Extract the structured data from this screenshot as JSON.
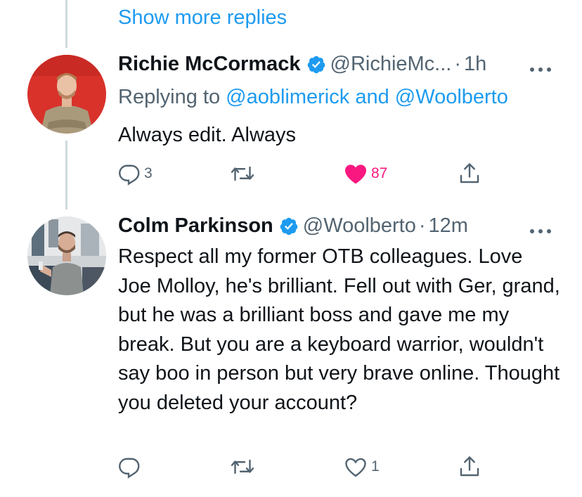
{
  "thread": {
    "show_more_label": "Show more replies"
  },
  "tweets": [
    {
      "display_name": "Richie McCormack",
      "handle": "@RichieMc...",
      "separator": "·",
      "time": "1h",
      "replying_prefix": "Replying to",
      "replying_to_1": "@aoblimerick",
      "replying_joiner": "and",
      "replying_to_2": "@Woolberto",
      "text": "Always edit. Always",
      "reply_count": "3",
      "retweet_count": "",
      "like_count": "87",
      "liked": true
    },
    {
      "display_name": "Colm Parkinson",
      "handle": "@Woolberto",
      "separator": "·",
      "time": "12m",
      "text": "Respect all my former OTB colleagues. Love Joe Molloy, he's brilliant. Fell out with Ger, grand, but he was a brilliant boss and gave me my break. But you are a keyboard warrior, wouldn't say boo in person but very brave online. Thought you deleted your account?",
      "reply_count": "",
      "retweet_count": "",
      "like_count": "1",
      "liked": false
    }
  ],
  "colors": {
    "accent": "#1d9bf0",
    "secondary_text": "#536471",
    "like_pink": "#f91880",
    "thread_line": "#cfd9de"
  },
  "icons": [
    "reply-icon",
    "retweet-icon",
    "like-icon",
    "share-icon",
    "verified-badge-icon",
    "more-options-icon"
  ]
}
